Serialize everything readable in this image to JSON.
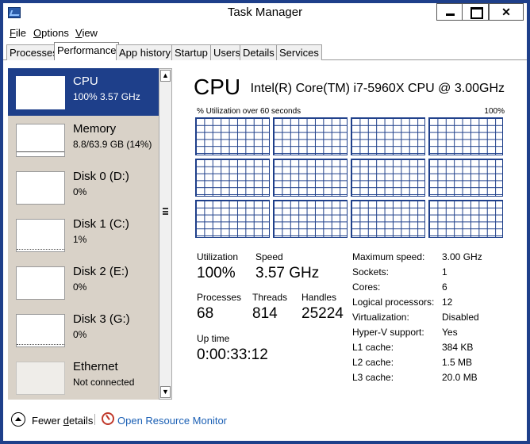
{
  "window": {
    "title": "Task Manager"
  },
  "menu": {
    "file": {
      "hotkey": "F",
      "rest": "ile"
    },
    "options": {
      "hotkey": "O",
      "rest": "ptions"
    },
    "view": {
      "hotkey": "V",
      "rest": "iew"
    }
  },
  "tabs": [
    "Processes",
    "Performance",
    "App history",
    "Startup",
    "Users",
    "Details",
    "Services"
  ],
  "active_tab": "Performance",
  "resources": [
    {
      "name": "CPU",
      "detail": "100%  3.57 GHz"
    },
    {
      "name": "Memory",
      "detail": "8.8/63.9 GB (14%)"
    },
    {
      "name": "Disk 0 (D:)",
      "detail": "0%"
    },
    {
      "name": "Disk 1 (C:)",
      "detail": "1%"
    },
    {
      "name": "Disk 2 (E:)",
      "detail": "0%"
    },
    {
      "name": "Disk 3 (G:)",
      "detail": "0%"
    },
    {
      "name": "Ethernet",
      "detail": "Not connected"
    }
  ],
  "cpu": {
    "title": "CPU",
    "model": "Intel(R) Core(TM) i7-5960X CPU @ 3.00GHz",
    "graph_caption": "% Utilization over 60 seconds",
    "graph_max": "100%",
    "logical_core_graphs": 12,
    "stats": {
      "utilization_label": "Utilization",
      "utilization": "100%",
      "speed_label": "Speed",
      "speed": "3.57 GHz",
      "processes_label": "Processes",
      "processes": "68",
      "threads_label": "Threads",
      "threads": "814",
      "handles_label": "Handles",
      "handles": "25224",
      "uptime_label": "Up time",
      "uptime": "0:00:33:12"
    },
    "info": [
      {
        "label": "Maximum speed:",
        "value": "3.00 GHz"
      },
      {
        "label": "Sockets:",
        "value": "1"
      },
      {
        "label": "Cores:",
        "value": "6"
      },
      {
        "label": "Logical processors:",
        "value": "12"
      },
      {
        "label": "Virtualization:",
        "value": "Disabled"
      },
      {
        "label": "Hyper-V support:",
        "value": "Yes"
      },
      {
        "label": "L1 cache:",
        "value": "384 KB"
      },
      {
        "label": "L2 cache:",
        "value": "1.5 MB"
      },
      {
        "label": "L3 cache:",
        "value": "20.0 MB"
      }
    ]
  },
  "footer": {
    "fewer_details_hotkey_prefix": "Fewer ",
    "fewer_details_hotkey": "d",
    "fewer_details_rest": "etails",
    "resource_monitor": "Open Resource Monitor"
  },
  "colors": {
    "selection": "#1e3f8a",
    "graph_line": "#1e3f8a",
    "link": "#1a5fb4",
    "sidebar": "#d9d2c8"
  }
}
